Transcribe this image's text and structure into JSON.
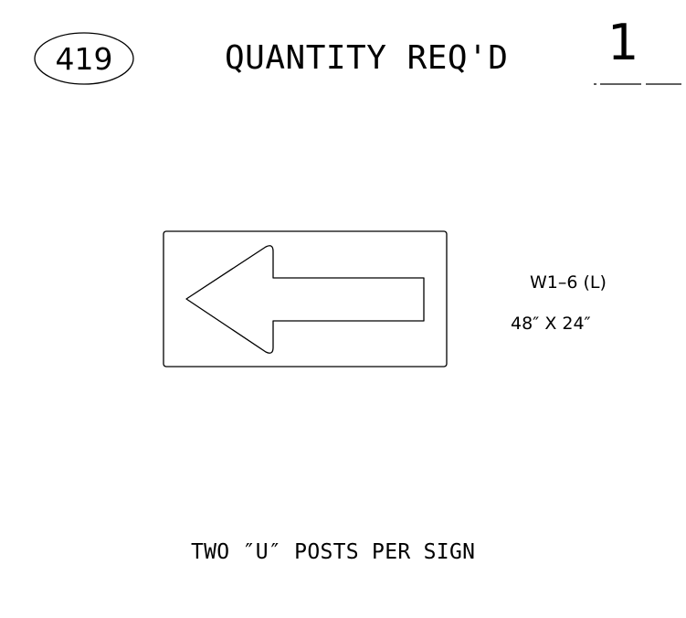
{
  "sheet": {
    "number": "419",
    "quantity_label": "QUANTITY REQ'D",
    "quantity_value": "1"
  },
  "sign": {
    "code": "W1–6  (L)",
    "size": "48″ X 24″",
    "arrow_direction": "left"
  },
  "notes": {
    "posts": "TWO ″U″ POSTS PER SIGN"
  },
  "colors": {
    "line": "#000000",
    "background": "#ffffff"
  }
}
